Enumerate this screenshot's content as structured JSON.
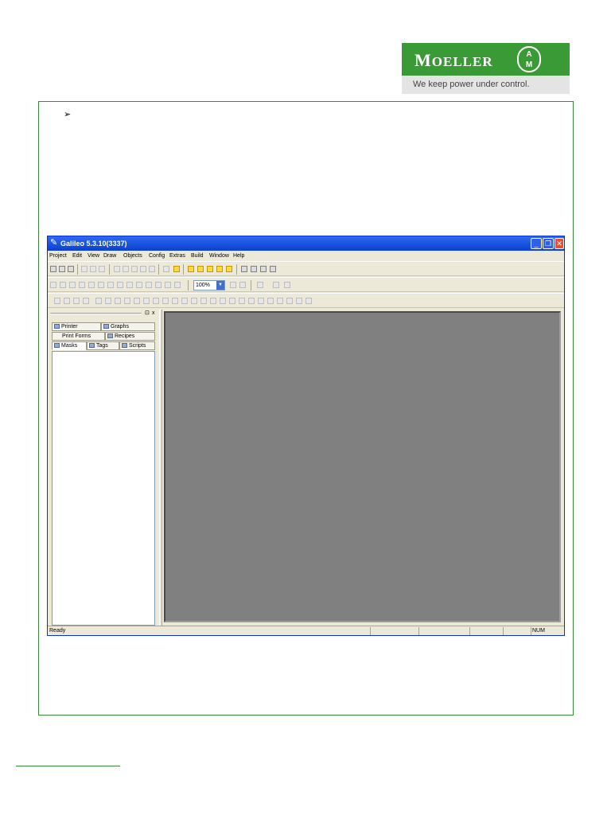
{
  "logo": {
    "brand_big": "M",
    "brand_rest": "OELLER",
    "seal_text": "A\nM",
    "tagline": "We keep power under control."
  },
  "bullet": "➢",
  "window": {
    "title": "Galileo 5.3.10(3337)",
    "menu": [
      "Project",
      "Edit",
      "View",
      "Draw",
      "Objects",
      "Config",
      "Extras",
      "Build",
      "Window",
      "Help"
    ],
    "zoom": "100%",
    "panel": {
      "pin_label": "⊡",
      "close_label": "x",
      "tabs_row1": [
        "Printer",
        "Graphs"
      ],
      "tabs_row2": [
        "Print Forms",
        "Recipes"
      ],
      "tabs_row3": [
        "Masks",
        "Tags",
        "Scripts"
      ]
    },
    "status": {
      "text": "Ready",
      "num": "NUM"
    }
  },
  "colors": {
    "brand_green": "#3a9a35",
    "title_blue": "#0a3fd0",
    "workspace_gray": "#808080",
    "chrome": "#ece9d8"
  }
}
